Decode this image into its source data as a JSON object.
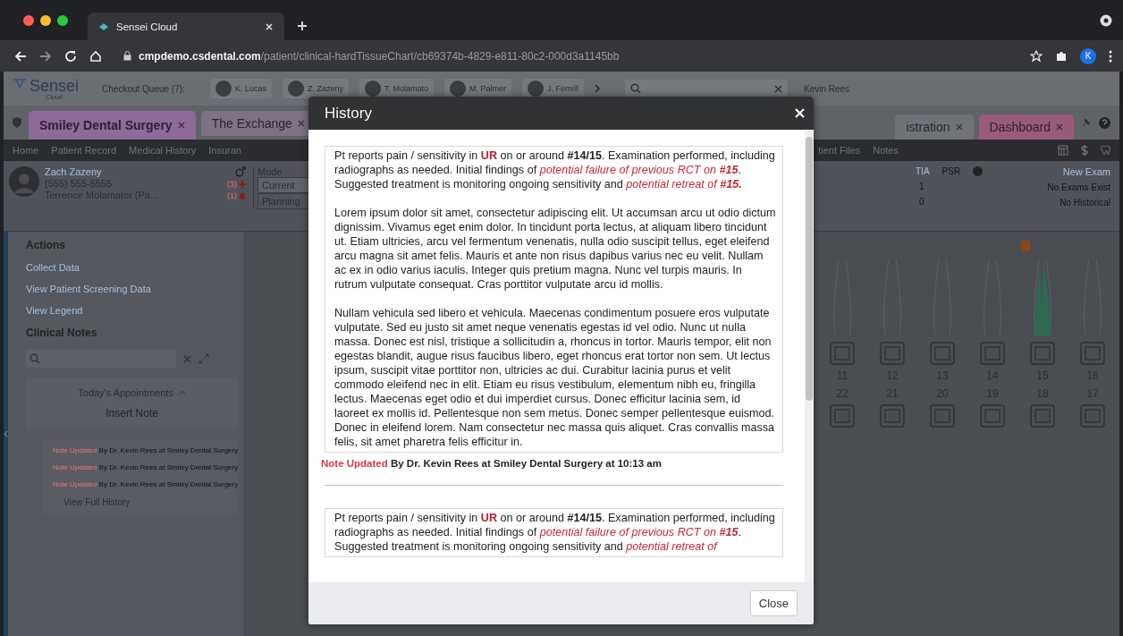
{
  "browser": {
    "tab_title": "Sensei Cloud",
    "url_host": "cmpdemo.csdental.com",
    "url_path": "/patient/clinical-hardTissueChart/cb69374b-4829-e811-80c2-000d3a1145bb",
    "profile_initial": "K"
  },
  "app": {
    "logo": {
      "name": "Sensei",
      "sub": "Cloud"
    },
    "checkout_queue": {
      "label": "Checkout Queue (7):",
      "patients": [
        "K. Lucas",
        "Z. Zazeny",
        "T. Molamato",
        "M. Palmer",
        "J. Ferrell"
      ]
    },
    "user": "Kevin Rees",
    "office_tabs_left": [
      {
        "label": "Smiley Dental Surgery",
        "selected": true,
        "color": "#8e6a9a"
      },
      {
        "label": "The Exchange",
        "selected": false,
        "color": "#7d7384"
      }
    ],
    "office_tabs_right": [
      {
        "label": "istration",
        "selected": false,
        "color": "#6f7378"
      },
      {
        "label": "Dashboard",
        "selected": false,
        "color": "#9a5a7a"
      }
    ],
    "nav_left": [
      "Home",
      "Patient Record",
      "Medical History",
      "Insuran"
    ],
    "nav_right": [
      "tient Files",
      "Notes"
    ],
    "patient": {
      "name": "Zach Zazeny",
      "phone": "(555) 555-5555",
      "provider": "Terrence Molamator (Pa...",
      "alert_count": "(3)",
      "bell_count": "(1)"
    },
    "mode": {
      "label": "Mode",
      "options": [
        {
          "label": "Current",
          "selected": true
        },
        {
          "label": "Planning",
          "selected": false
        }
      ]
    },
    "actions": {
      "title": "Actions",
      "items": [
        "Collect Data",
        "View Patient Screening Data",
        "View Legend"
      ]
    },
    "clinical_notes": {
      "title": "Clinical Notes",
      "appointment": "Today's Appointments",
      "insert": "Insert Note",
      "history": [
        {
          "status": "Note Updated",
          "detail": "By Dr. Kevin Rees at Smiley Dental Surgery"
        },
        {
          "status": "Note Updated",
          "detail": "By Dr. Kevin Rees at Smiley Dental Surgery"
        },
        {
          "status": "Note Updated",
          "detail": "By Dr. Kevin Rees at Smiley Dental Surgery"
        }
      ],
      "view_history": "View Full History"
    },
    "exam": {
      "headers": [
        "TIA",
        "PSR"
      ],
      "values": [
        "1",
        "0"
      ],
      "new_exam": "New Exam",
      "no_exams": "No Exams Exist",
      "no_historical": "No Historical"
    },
    "teeth": {
      "upper": [
        {
          "number": "11",
          "treated": false
        },
        {
          "number": "12",
          "treated": false
        },
        {
          "number": "13",
          "treated": false
        },
        {
          "number": "14",
          "treated": false
        },
        {
          "number": "15",
          "treated": true
        },
        {
          "number": "16",
          "treated": false
        }
      ],
      "lower": [
        "22",
        "21",
        "20",
        "19",
        "18",
        "17"
      ]
    }
  },
  "modal": {
    "title": "History",
    "close_label": "Close",
    "entries": [
      {
        "paragraphs": [
          [
            {
              "kind": "plain",
              "text": "Pt reports pain / sensitivity in "
            },
            {
              "kind": "alert",
              "text": "UR"
            },
            {
              "kind": "plain",
              "text": " on or around "
            },
            {
              "kind": "bold",
              "text": "#14/15"
            },
            {
              "kind": "plain",
              "text": ". Examination performed, including radiographs as needed. Initial findings of "
            },
            {
              "kind": "finding",
              "text": "potential failure of previous RCT on "
            },
            {
              "kind": "finding-bold",
              "text": "#15"
            },
            {
              "kind": "plain",
              "text": ". Suggested treatment is monitoring ongoing sensitivity and "
            },
            {
              "kind": "finding",
              "text": "potential retreat of "
            },
            {
              "kind": "finding-bold",
              "text": "#15."
            }
          ],
          [
            {
              "kind": "plain",
              "text": "Lorem ipsum dolor sit amet, consectetur adipiscing elit. Ut accumsan arcu ut odio dictum dignissim. Vivamus eget enim dolor. In tincidunt porta lectus, at aliquam libero tincidunt ut. Etiam ultricies, arcu vel fermentum venenatis, nulla odio suscipit tellus, eget eleifend arcu magna sit amet felis. Mauris et ante non risus dapibus varius nec eu velit. Nullam ac ex in odio varius iaculis. Integer quis pretium magna. Nunc vel turpis mauris. In rutrum vulputate consequat. Cras porttitor vulputate arcu id mollis."
            }
          ],
          [
            {
              "kind": "plain",
              "text": "Nullam vehicula sed libero et vehicula. Maecenas condimentum posuere eros vulputate vulputate. Sed eu justo sit amet neque venenatis egestas id vel odio. Nunc ut nulla massa. Donec est nisl, tristique a sollicitudin a, rhoncus in tortor. Mauris tempor, elit non egestas blandit, augue risus faucibus libero, eget rhoncus erat tortor non sem. Ut lectus ipsum, suscipit vitae porttitor non, ultricies ac dui. Curabitur lacinia purus et velit commodo eleifend nec in elit. Etiam eu risus vestibulum, elementum nibh eu, fringilla lectus. Maecenas eget odio et dui imperdiet cursus. Donec efficitur lacinia sem, id laoreet ex mollis id. Pellentesque non sem metus. Donec semper pellentesque euismod. Donec in eleifend lorem. Nam consectetur nec massa quis aliquet. Cras convallis massa felis, sit amet pharetra felis efficitur in."
            }
          ]
        ],
        "status": "Note Updated",
        "detail": "By Dr. Kevin Rees at Smiley Dental Surgery at 10:13 am"
      },
      {
        "paragraphs": [
          [
            {
              "kind": "plain",
              "text": "Pt reports pain / sensitivity in "
            },
            {
              "kind": "alert",
              "text": "UR"
            },
            {
              "kind": "plain",
              "text": " on or around "
            },
            {
              "kind": "bold",
              "text": "#14/15"
            },
            {
              "kind": "plain",
              "text": ". Examination performed, including radiographs as needed. Initial findings of "
            },
            {
              "kind": "finding",
              "text": "potential failure of previous RCT on "
            },
            {
              "kind": "finding-bold",
              "text": "#15"
            },
            {
              "kind": "plain",
              "text": ". Suggested treatment is monitoring ongoing sensitivity and "
            },
            {
              "kind": "finding",
              "text": "potential retreat of"
            }
          ]
        ]
      }
    ]
  }
}
